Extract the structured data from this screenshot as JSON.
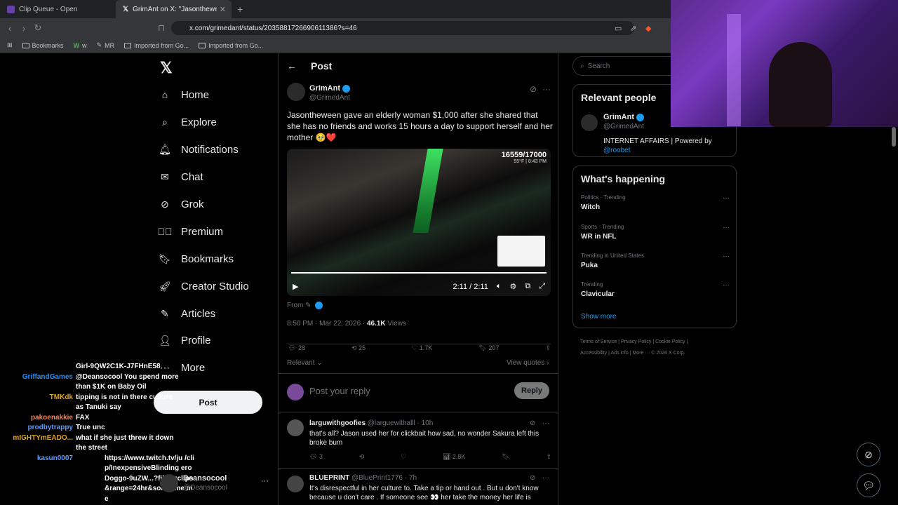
{
  "browser": {
    "tabs": [
      {
        "title": "Clip Queue - Open",
        "active": false
      },
      {
        "title": "GrimAnt on X: \"Jasontheween g",
        "active": true
      }
    ],
    "url": "x.com/grimedant/status/2035881726690611386?s=46",
    "bookmarks": [
      "Bookmarks",
      "w",
      "MR",
      "Imported from Go...",
      "Imported from Go..."
    ]
  },
  "nav": {
    "items": [
      "Home",
      "Explore",
      "Notifications",
      "Chat",
      "Grok",
      "Premium",
      "Bookmarks",
      "Creator Studio",
      "Articles",
      "Profile",
      "More"
    ],
    "post_label": "Post",
    "account": {
      "name": "Deansocool",
      "handle": "@Deansocool"
    }
  },
  "post": {
    "header": "Post",
    "author": "GrimAnt",
    "handle": "@GrimedAnt",
    "text": "Jasontheween gave an elderly woman $1,000 after she shared that she has no friends and works 15 hours a day to support herself and her mother 🥹❤️",
    "video": {
      "counter": "16559/17000",
      "weather": "55°F | 8:43 PM",
      "time": "2:11 / 2:11",
      "progress": 1.0
    },
    "from_label": "From",
    "timestamp": "8:50 PM · Mar 22, 2026 ·",
    "views_count": "46.1K",
    "views_label": "Views",
    "stats": {
      "replies": "28",
      "reposts": "25",
      "likes": "1.7K",
      "bookmarks": "207"
    },
    "sort_label": "Relevant",
    "quotes_label": "View quotes",
    "reply_placeholder": "Post your reply",
    "reply_button": "Reply"
  },
  "comments": [
    {
      "name": "larguwithgoofies",
      "handle": "@larguewithalll · 10h",
      "text": "that's all? Jason used her for clickbait how sad, no wonder Sakura left this broke bum",
      "replies": "3",
      "views": "2.8K"
    },
    {
      "name": "BLUEPRINT",
      "handle": "@BluePrint1776 · 7h",
      "text": "It's disrespectful in her culture  to. Take a tip or hand out . But u don't know because u don't care . If someone see 👀  her take the money  her life is"
    }
  ],
  "sidebar": {
    "search_placeholder": "Search",
    "relevant_title": "Relevant people",
    "relevant_person": {
      "name": "GrimAnt",
      "handle": "@GrimedAnt",
      "bio": "INTERNET AFFAIRS | Powered by",
      "link": "@roobet"
    },
    "happening_title": "What's happening",
    "trends": [
      {
        "category": "Politics · Trending",
        "title": "Witch"
      },
      {
        "category": "Sports · Trending",
        "title": "WR in NFL"
      },
      {
        "category": "Trending in United States",
        "title": "Puka"
      },
      {
        "category": "Trending",
        "title": "Clavicular"
      }
    ],
    "show_more": "Show more",
    "footer": [
      "Terms of Service",
      "Privacy Policy",
      "Cookie Policy",
      "Accessibility",
      "Ads info",
      "More ···",
      "© 2026 X Corp."
    ]
  },
  "stream_chat": [
    {
      "user": "",
      "color": "#ffffff",
      "msg": "Girl-9QW2C1K-J7FHnE58"
    },
    {
      "user": "GriffandGames",
      "color": "#1e90ff",
      "msg": "@Deansocool You spend more than $1K on Baby Oil"
    },
    {
      "user": "TMKdk",
      "color": "#daa520",
      "msg": "tipping is not in there culture as Tanuki say"
    },
    {
      "user": "pakoenakkie",
      "color": "#ff7f50",
      "msg": "FAX"
    },
    {
      "user": "prodbytrappy",
      "color": "#5b9bff",
      "msg": "True unc"
    },
    {
      "user": "mIGHTYmEADO...",
      "color": "#daa520",
      "msg": "what if she just threw it down the street"
    },
    {
      "user": "kasun0007",
      "color": "#5b9bff",
      "msg": "https://www.twitch.tv/ju /clip/InexpensiveBlinding eroDoggo-9uZW...?filter=clips&range=24hr&sort=time me"
    }
  ]
}
